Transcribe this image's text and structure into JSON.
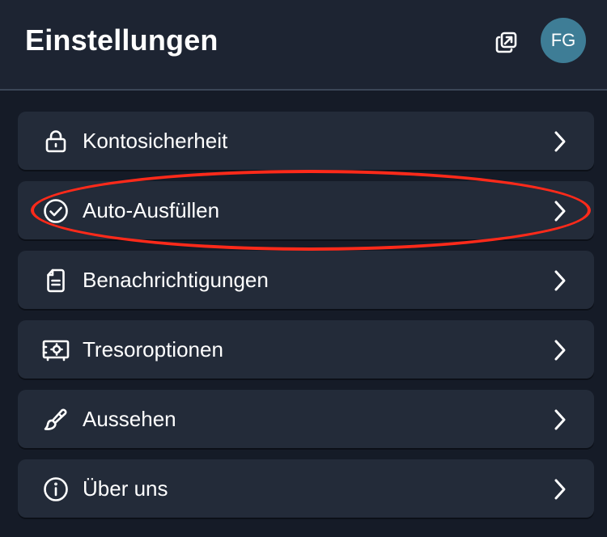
{
  "header": {
    "title": "Einstellungen",
    "avatar_initials": "FG",
    "avatar_color": "#3e7d96"
  },
  "menu": {
    "items": [
      {
        "label": "Kontosicherheit",
        "icon": "lock-icon"
      },
      {
        "label": "Auto-Ausfüllen",
        "icon": "check-circle-icon"
      },
      {
        "label": "Benachrichtigungen",
        "icon": "document-icon"
      },
      {
        "label": "Tresoroptionen",
        "icon": "vault-icon"
      },
      {
        "label": "Aussehen",
        "icon": "brush-icon"
      },
      {
        "label": "Über uns",
        "icon": "info-icon"
      }
    ]
  },
  "colors": {
    "background": "#151b27",
    "header": "#1d2432",
    "card": "#232b39",
    "highlight": "#ff2a1a"
  }
}
